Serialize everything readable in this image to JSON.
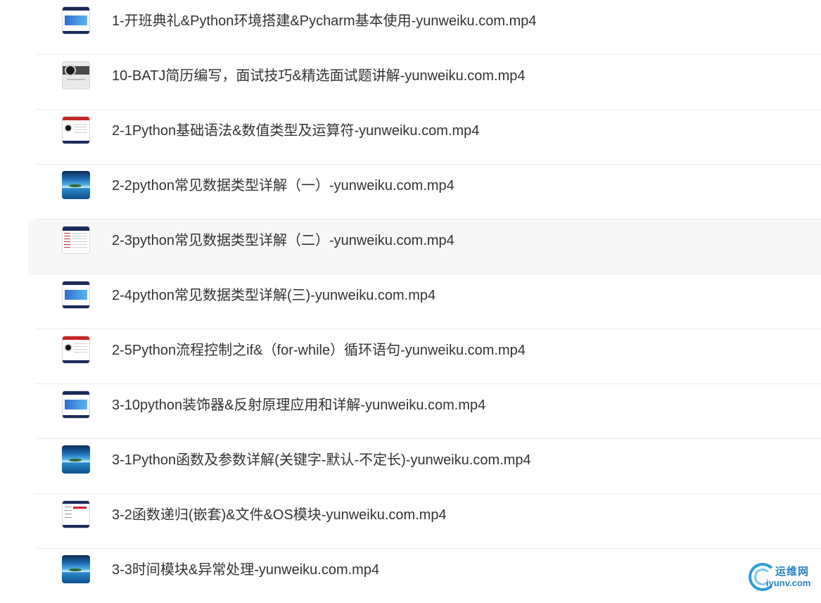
{
  "files": [
    {
      "name": "1-开班典礼&Python环境搭建&Pycharm基本使用-yunweiku.com.mp4",
      "thumb": "doc-blue"
    },
    {
      "name": "10-BATJ简历编写，面试技巧&精选面试题讲解-yunweiku.com.mp4",
      "thumb": "logo-grey"
    },
    {
      "name": "2-1Python基础语法&数值类型及运算符-yunweiku.com.mp4",
      "thumb": "doc-red"
    },
    {
      "name": "2-2python常见数据类型详解（一）-yunweiku.com.mp4",
      "thumb": "seascape"
    },
    {
      "name": "2-3python常见数据类型详解（二）-yunweiku.com.mp4",
      "thumb": "doc-navy"
    },
    {
      "name": "2-4python常见数据类型详解(三)-yunweiku.com.mp4",
      "thumb": "doc-blue"
    },
    {
      "name": "2-5Python流程控制之if&（for-while）循环语句-yunweiku.com.mp4",
      "thumb": "doc-red"
    },
    {
      "name": "3-10python装饰器&反射原理应用和详解-yunweiku.com.mp4",
      "thumb": "doc-blue"
    },
    {
      "name": "3-1Python函数及参数详解(关键字-默认-不定长)-yunweiku.com.mp4",
      "thumb": "seascape"
    },
    {
      "name": "3-2函数递归(嵌套)&文件&OS模块-yunweiku.com.mp4",
      "thumb": "doc-blank"
    },
    {
      "name": "3-3时间模块&异常处理-yunweiku.com.mp4",
      "thumb": "seascape"
    }
  ],
  "hovered_index": 4,
  "watermark": {
    "cn": "运维网",
    "url": "iyunv.com"
  },
  "colors": {
    "text": "#333333",
    "divider": "#ececec",
    "hover": "#f7f7f7",
    "watermark": "#2a7fc1"
  }
}
